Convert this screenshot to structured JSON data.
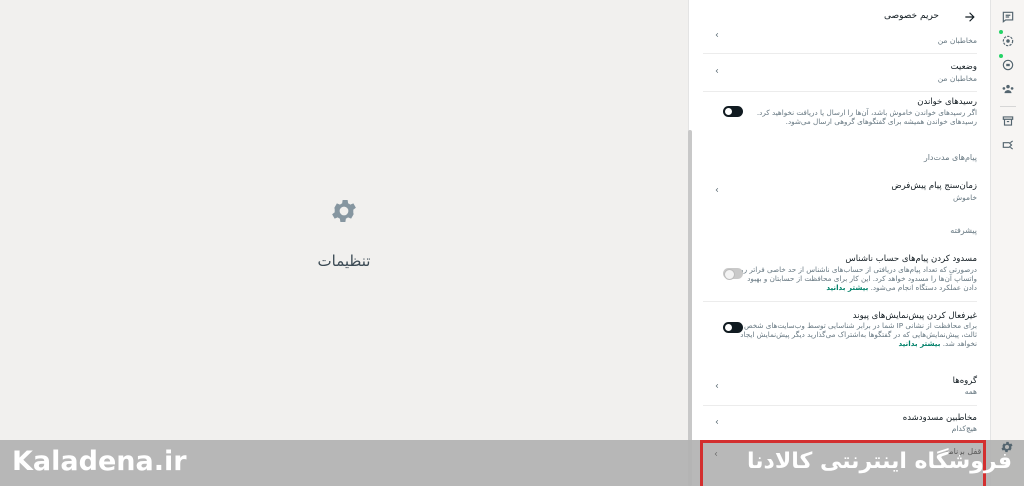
{
  "left_pane": {
    "title": "تنظیمات",
    "icon": "gear-icon"
  },
  "header": {
    "back_icon": "arrow-right-icon",
    "title": "حریم خصوصی"
  },
  "items": {
    "partial_top": {
      "subtitle": "مخاطبان من"
    },
    "status": {
      "title": "وضعیت",
      "subtitle": "مخاطبان من"
    },
    "read_receipts": {
      "title": "رسیدهای خواندن",
      "description": "اگر رسیدهای خواندن خاموش باشد، آن‌ها را ارسال یا دریافت نخواهید کرد. رسیدهای خواندن همیشه برای گفتگوهای گروهی ارسال می‌شود.",
      "enabled": false
    },
    "disappearing_section": "پیام‌های مدت‌دار",
    "default_timer": {
      "title": "زمان‌سنج پیام پیش‌فرض",
      "subtitle": "خاموش"
    },
    "advanced_section": "پیشرفته",
    "block_unknown": {
      "title": "مسدود کردن پیام‌های حساب ناشناس",
      "description": "درصورتی که تعداد پیام‌های دریافتی از حساب‌های ناشناس از حد خاصی فراتر رود، واتساپ آن‌ها را مسدود خواهد کرد. این کار برای محافظت از حسابتان و بهبود دادن عملکرد دستگاه انجام می‌شود.",
      "link": "بیشتر بدانید",
      "enabled": false,
      "disabled_state": true
    },
    "link_previews": {
      "title": "غیرفعال کردن پیش‌نمایش‌های پیوند",
      "description": "برای محافظت از نشانی IP شما در برابر شناسایی توسط وب‌سایت‌های شخص ثالث، پیش‌نمایش‌هایی که در گفتگوها به‌اشتراک می‌گذارید دیگر پیش‌نمایش ایجاد نخواهد شد.",
      "link": "بیشتر بدانید",
      "enabled": false
    },
    "groups": {
      "title": "گروه‌ها",
      "subtitle": "همه"
    },
    "blocked_contacts": {
      "title": "مخاطبین مسدودشده",
      "subtitle": "هیچ‌کدام"
    },
    "app_lock": {
      "title": "قفل برنامه"
    }
  },
  "rail": {
    "icons": [
      "chats-icon",
      "status-icon",
      "channels-icon",
      "communities-icon",
      "archive-icon",
      "starred-icon",
      "settings-icon"
    ]
  },
  "banner": {
    "brand": "Kaladena.ir",
    "shop": "فروشگاه اینترنتی کالادنا"
  }
}
